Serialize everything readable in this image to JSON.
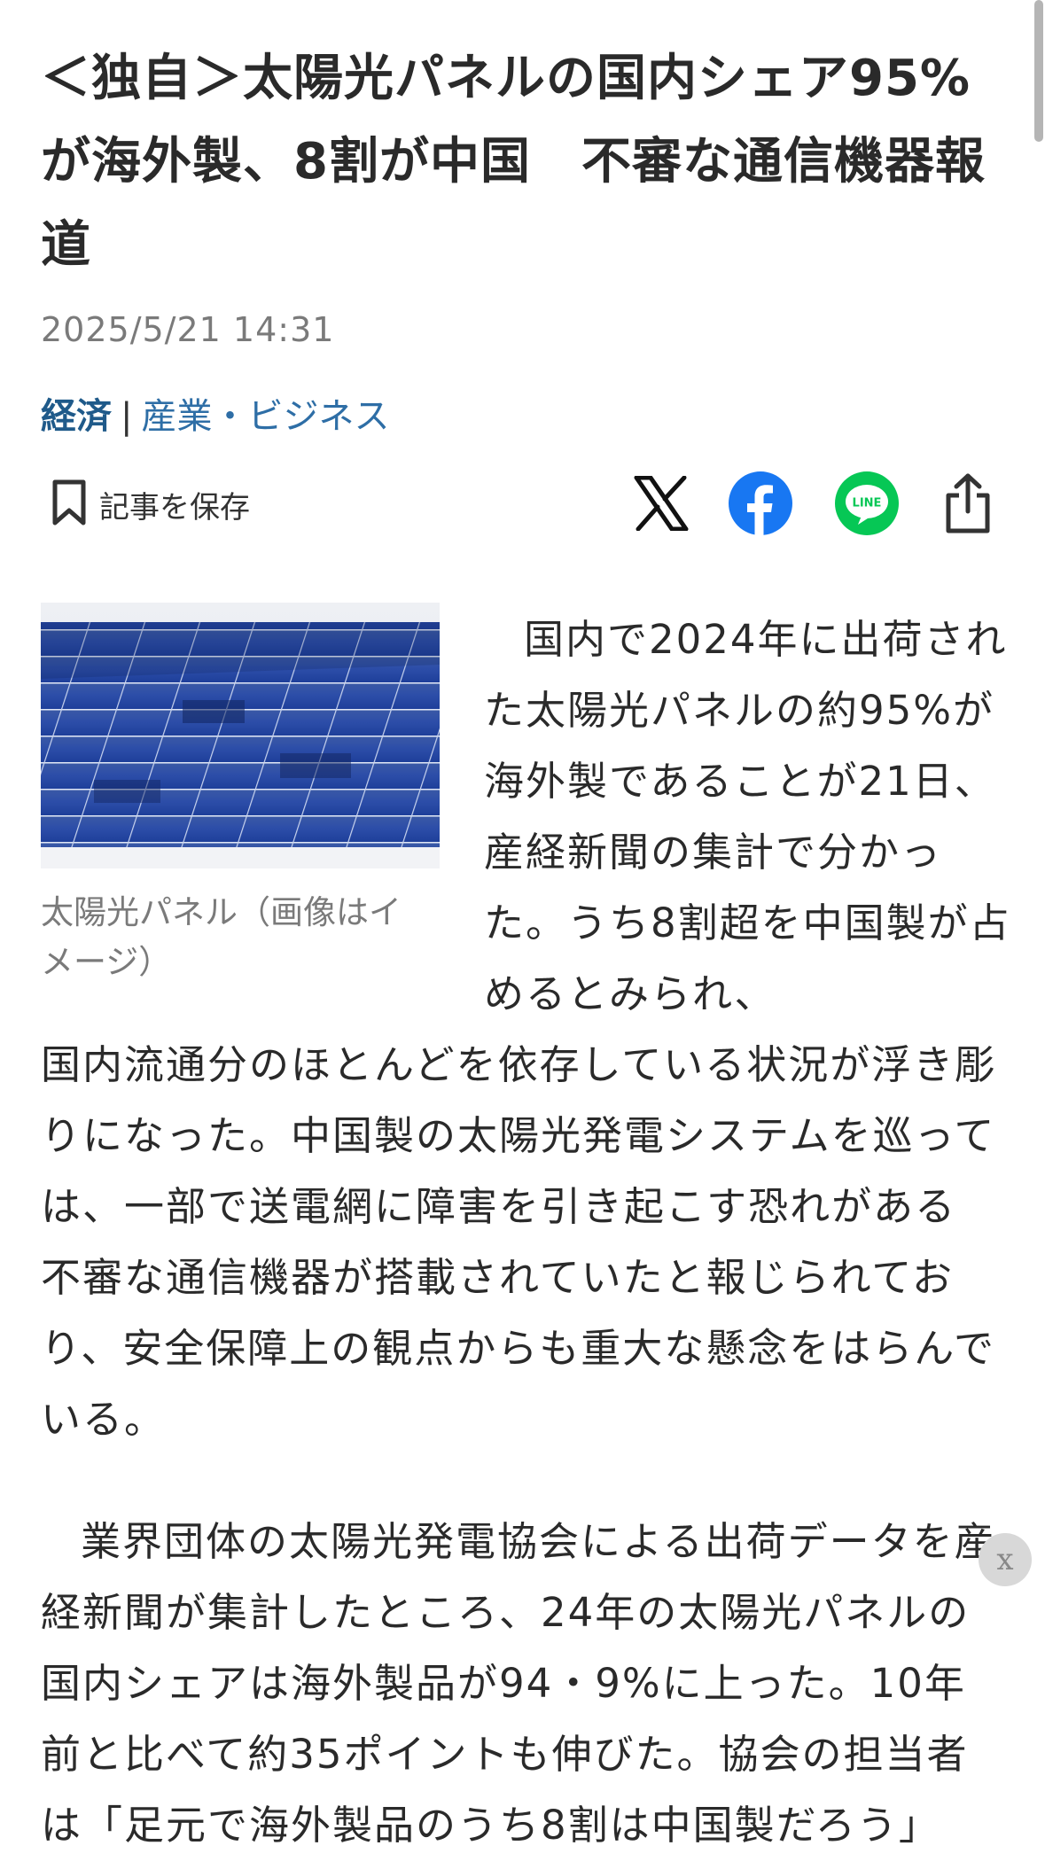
{
  "article": {
    "headline": "＜独自＞太陽光パネルの国内シェア95%が海外製、8割が中国　不審な通信機器報道",
    "date": "2025/5/21 14:31",
    "category_primary": "経済",
    "category_separator": "|",
    "category_secondary": "産業・ビジネス",
    "save_label": "記事を保存",
    "image_caption": "太陽光パネル（画像はイメージ）",
    "paragraph1_beside_image": "国内で2024年に出荷された太陽光パネルの約95%が海外製であることが21日、産経新聞の集計で分かった。うち8割超を中国製が占めるとみられ、",
    "paragraph1_continued": "国内流通分のほとんどを依存している状況が浮き彫りになった。中国製の太陽光発電システムを巡っては、一部で送電網に障害を引き起こす恐れがある不審な通信機器が搭載されていたと報じられており、安全保障上の観点からも重大な懸念をはらんでいる。",
    "paragraph2": "業界団体の太陽光発電協会による出荷データを産経新聞が集計したところ、24年の太陽光パネルの国内シェアは海外製品が94・9%に上った。10年前と比べて約35ポイントも伸びた。協会の担当者は「足元で海外製品のうち8割は中国製だろう」"
  },
  "share": {
    "x_icon": "x-logo-icon",
    "facebook_icon": "facebook-icon",
    "line_icon": "line-icon",
    "line_text": "LINE",
    "share_icon": "share-icon"
  },
  "overlay": {
    "close_label": "x"
  },
  "colors": {
    "category": "#1f5a8a",
    "facebook": "#1877f2",
    "line": "#06c755",
    "text": "#2a2a2a",
    "muted": "#7a7a7a"
  }
}
